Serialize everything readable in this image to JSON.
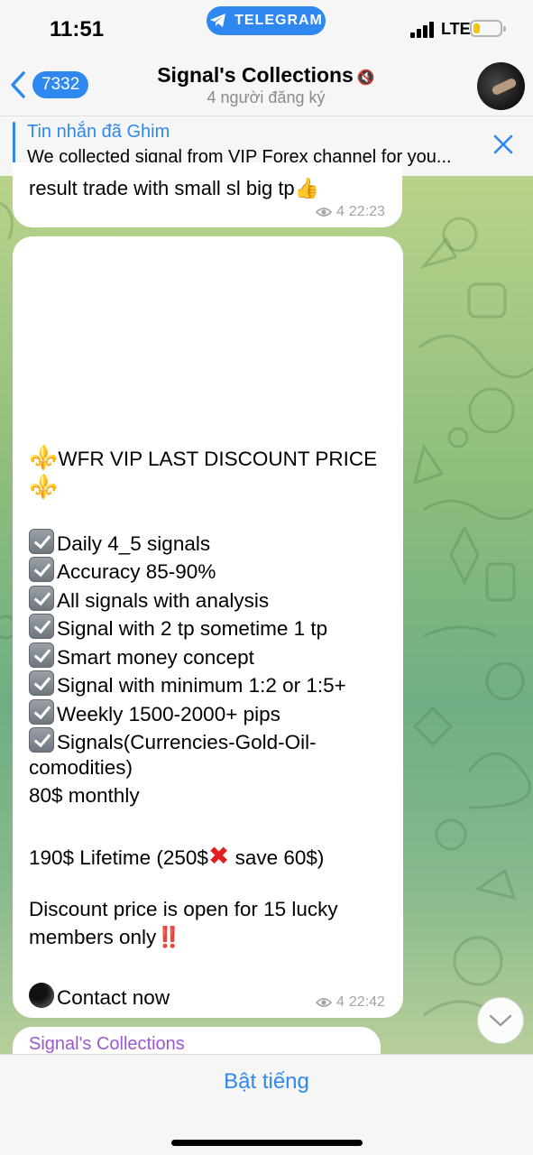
{
  "status_bar": {
    "time": "11:51",
    "app_pill": "TELEGRAM",
    "network": "LTE",
    "battery_level": 0.25
  },
  "header": {
    "back_count": "7332",
    "title": "Signal's Collections",
    "subtitle": "4 người đăng ký"
  },
  "pinned": {
    "title": "Tin nhắn đã Ghim",
    "text": "We collected signal from VIP Forex channel for you..."
  },
  "messages": [
    {
      "text": "result trade with small sl big tp",
      "views": "4",
      "time": "22:23"
    },
    {
      "lines": {
        "title": "WFR VIP LAST DISCOUNT PRICE",
        "f1": "Daily 4_5 signals",
        "f2": "Accuracy 85-90%",
        "f3": "All signals with analysis",
        "f4": "Signal with 2 tp sometime 1 tp",
        "f5": "Smart money concept",
        "f6": "Signal with minimum 1:2 or 1:5+",
        "f7": "Weekly  1500-2000+ pips",
        "f8a": "Signals(Currencies-Gold-Oil-",
        "f8b": "comodities)",
        "monthly": "80$ monthly",
        "lifetime_a": "190$ Lifetime (250$",
        "lifetime_b": " save 60$)",
        "discount_a": "Discount price is open for 15 lucky",
        "discount_b": "members only",
        "contact": "Contact now"
      },
      "views": "4",
      "time": "22:42"
    },
    {
      "sender": "Signal's Collections"
    }
  ],
  "bottom": {
    "unmute_label": "Bật tiếng"
  },
  "colors": {
    "accent": "#2f88f0",
    "sender_name": "#9b59d0"
  }
}
